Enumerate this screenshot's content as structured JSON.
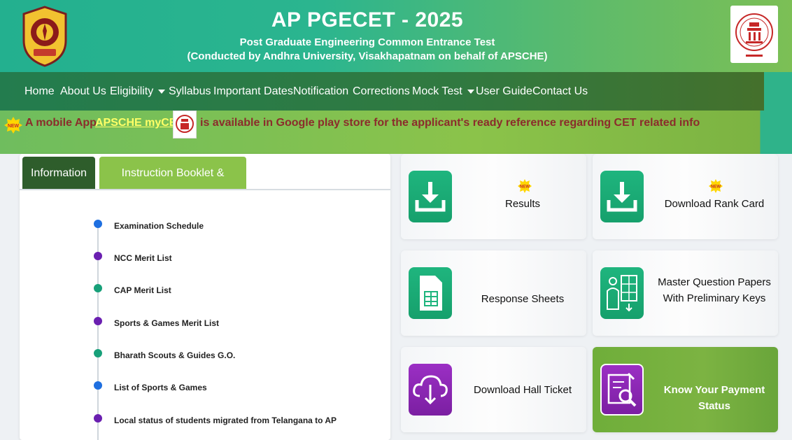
{
  "header": {
    "title": "AP PGECET - 2025",
    "subtitle": "Post Graduate Engineering Common Entrance Test",
    "conducted_by": "(Conducted by Andhra University, Visakhapatnam on behalf of APSCHE)"
  },
  "nav": {
    "items": [
      {
        "label": "Home"
      },
      {
        "label": "About Us"
      },
      {
        "label": "Eligibility",
        "dropdown": true
      },
      {
        "label": "Syllabus"
      },
      {
        "label": "Important Dates"
      },
      {
        "label": "Notification"
      },
      {
        "label": "Corrections"
      },
      {
        "label": "Mock Test",
        "dropdown": true
      },
      {
        "label": "User Guide"
      },
      {
        "label": "Contact Us"
      }
    ]
  },
  "marquee": {
    "badge": "NEW",
    "prefix": "A mobile App",
    "link": "APSCHE myCET",
    "suffix": "is available in Google play store for the applicant's ready reference regarding CET related info"
  },
  "tabs": [
    {
      "label": "Information",
      "active": true
    },
    {
      "label": "Instruction Booklet & Syllabus",
      "active": false
    }
  ],
  "timeline": [
    {
      "label": "Examination Schedule",
      "color": "#1e6fe0"
    },
    {
      "label": "NCC Merit List",
      "color": "#6a1fb0"
    },
    {
      "label": "CAP Merit List",
      "color": "#17a079"
    },
    {
      "label": "Sports & Games Merit List",
      "color": "#6a1fb0"
    },
    {
      "label": "Bharath Scouts & Guides G.O.",
      "color": "#17a079"
    },
    {
      "label": "List of Sports & Games",
      "color": "#1e6fe0"
    },
    {
      "label": "Local status of students migrated from Telangana to AP",
      "color": "#6a1fb0"
    }
  ],
  "cards": [
    {
      "label": "Results",
      "icon": "download-icon",
      "new": true
    },
    {
      "label": "Download Rank Card",
      "icon": "download-icon",
      "new": true
    },
    {
      "label": "Response Sheets",
      "icon": "document-sheet-icon",
      "new": false
    },
    {
      "label_line1": "Master Question Papers",
      "label_line2": "With Preliminary Keys",
      "icon": "question-paper-icon",
      "new": false
    },
    {
      "label": "Download Hall Ticket",
      "icon": "cloud-download-icon",
      "new": false
    },
    {
      "label_line1": "Know Your Payment",
      "label_line2": "Status",
      "icon": "payment-search-icon",
      "new": false
    }
  ],
  "new_badge_text": "NEW",
  "colors": {
    "header_green": "#2bb58f",
    "nav_dark": "#2e8a4a",
    "marquee_text": "#8b2c2c",
    "link_yellow": "#ffff66",
    "tab_active": "#2e5d2b",
    "tab_inactive": "#8bc34a",
    "icon_green": "#1fb57e",
    "icon_purple": "#9b2fc4"
  }
}
